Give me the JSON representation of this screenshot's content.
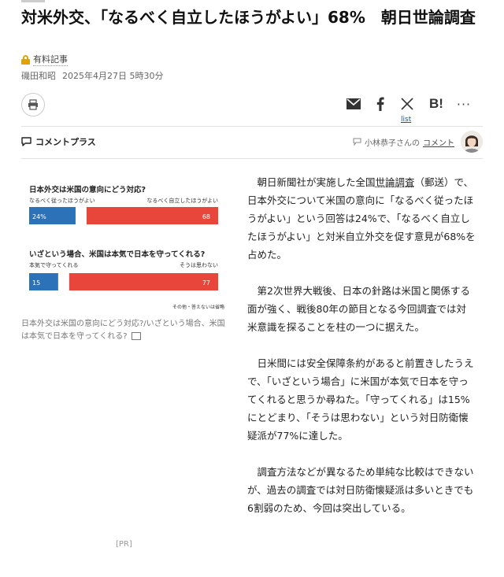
{
  "headline": {
    "text": "対米外交、「なるべく自立したほうがよい」68%　朝日世論調査"
  },
  "premium": {
    "label": "有料記事"
  },
  "meta": {
    "author": "磯田和昭",
    "date": "2025年4月27日 5時30分"
  },
  "share": {
    "list_label": "list",
    "hatena_label": "B!",
    "more_label": "···"
  },
  "comment_plus": {
    "brand": "コメントプラス",
    "commenter_prefix": "小林恭子さんの",
    "comment_link": "コメント"
  },
  "chart_data": [
    {
      "type": "bar",
      "title": "日本外交は米国の意向にどう対応?",
      "series": [
        {
          "name": "なるべく従ったほうがよい",
          "values": [
            24
          ],
          "color": "#2c72b8"
        },
        {
          "name": "なるべく自立したほうがよい",
          "values": [
            68
          ],
          "color": "#e8463a"
        }
      ],
      "value_labels": [
        "24%",
        "68"
      ]
    },
    {
      "type": "bar",
      "title": "いざという場合、米国は本気で日本を守ってくれる?",
      "series": [
        {
          "name": "本気で守ってくれる",
          "values": [
            15
          ],
          "color": "#2c72b8"
        },
        {
          "name": "そうは思わない",
          "values": [
            77
          ],
          "color": "#e8463a"
        }
      ],
      "value_labels": [
        "15",
        "77"
      ],
      "footnote": "その他・答えないは省略"
    }
  ],
  "chart_caption": "日本外交は米国の意向にどう対応?/いざという場合、米国は本気で日本を守ってくれる?",
  "pr_label": "[PR]",
  "article": {
    "p1_before": "朝日新聞社が実施した全国",
    "p1_link": "世論調査",
    "p1_after": "（郵送）で、日本外交について米国の意向に「なるべく従ったほうがよい」という回答は24%で、「なるべく自立したほうがよい」と対米自立外交を促す意見が68%を占めた。",
    "p2": "第2次世界大戦後、日本の針路は米国と関係する面が強く、戦後80年の節目となる今回調査では対米意識を探ることを柱の一つに据えた。",
    "p3": "日米間には安全保障条約があると前置きしたうえで、「いざという場合」に米国が本気で日本を守ってくれると思うか尋ねた。「守ってくれる」は15%にとどまり、「そうは思わない」という対日防衛懐疑派が77%に達した。",
    "p4": "調査方法などが異なるため単純な比較はできないが、過去の調査では対日防衛懐疑派は多いときでも6割弱のため、今回は突出している。"
  }
}
